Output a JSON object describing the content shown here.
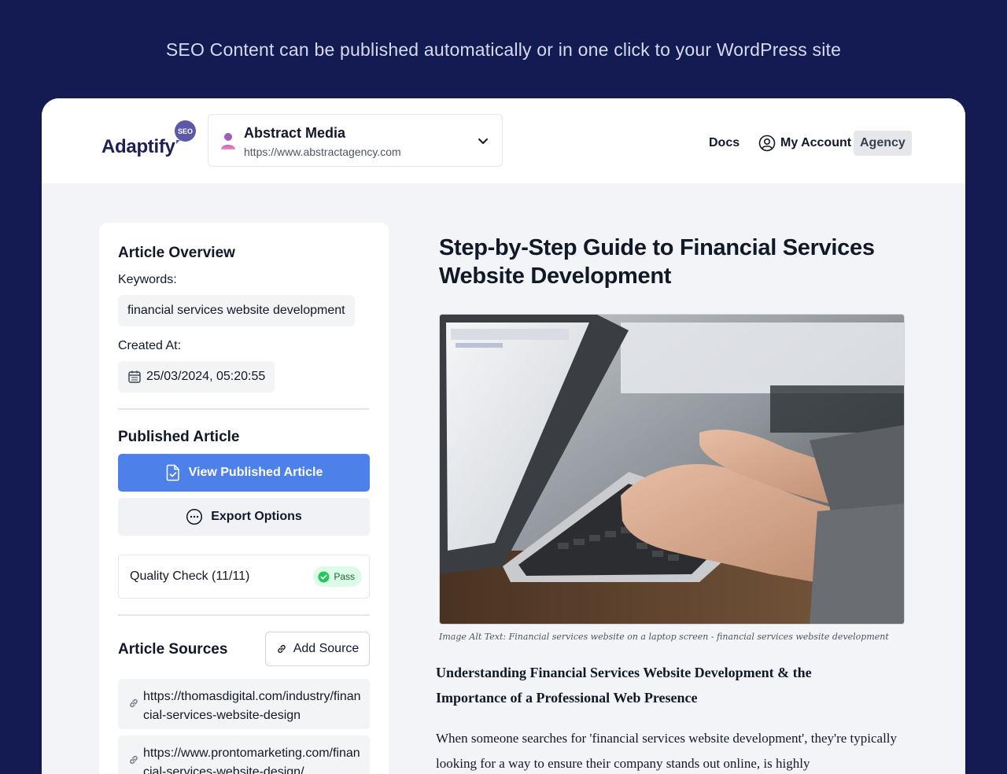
{
  "promo_text": "SEO Content can be published automatically or in one click to your WordPress site",
  "header": {
    "logo": "Adaptify",
    "logo_badge": "SEO",
    "site_name": "Abstract Media",
    "site_url": "https://www.abstractagency.com",
    "docs_label": "Docs",
    "account_label": "My Account",
    "plan_badge": "Agency"
  },
  "sidebar": {
    "overview_heading": "Article Overview",
    "keywords_label": "Keywords:",
    "keywords_value": "financial services website development",
    "created_label": "Created At:",
    "created_value": "25/03/2024, 05:20:55",
    "published_heading": "Published Article",
    "view_button": "View Published Article",
    "export_button": "Export Options",
    "quality_label": "Quality Check (11/11)",
    "quality_status": "Pass",
    "sources_heading": "Article Sources",
    "add_source_button": "Add Source",
    "sources": [
      "https://thomasdigital.com/industry/financial-services-website-design",
      "https://www.prontomarketing.com/financial-services-website-design/"
    ]
  },
  "article": {
    "title": "Step-by-Step Guide to Financial Services Website Development",
    "image_caption": "Image Alt Text: Financial services website on a laptop screen - financial services website development",
    "subheading": "Understanding Financial Services Website Development & the Importance of a Professional Web Presence",
    "body": "When someone searches for 'financial services website development', they're typically looking for a way to ensure their company stands out online, is highly"
  },
  "colors": {
    "background": "#141a52",
    "primary_button": "#4d80e8",
    "pass_badge": "#dcfce7",
    "logo_badge": "#5b58a8"
  },
  "icons": {
    "account": "user-circle-icon",
    "chevron": "chevron-down-icon",
    "calendar": "calendar-icon",
    "document": "document-check-icon",
    "export": "more-horizontal-circle-icon",
    "check": "check-circle-icon",
    "link": "link-icon"
  }
}
